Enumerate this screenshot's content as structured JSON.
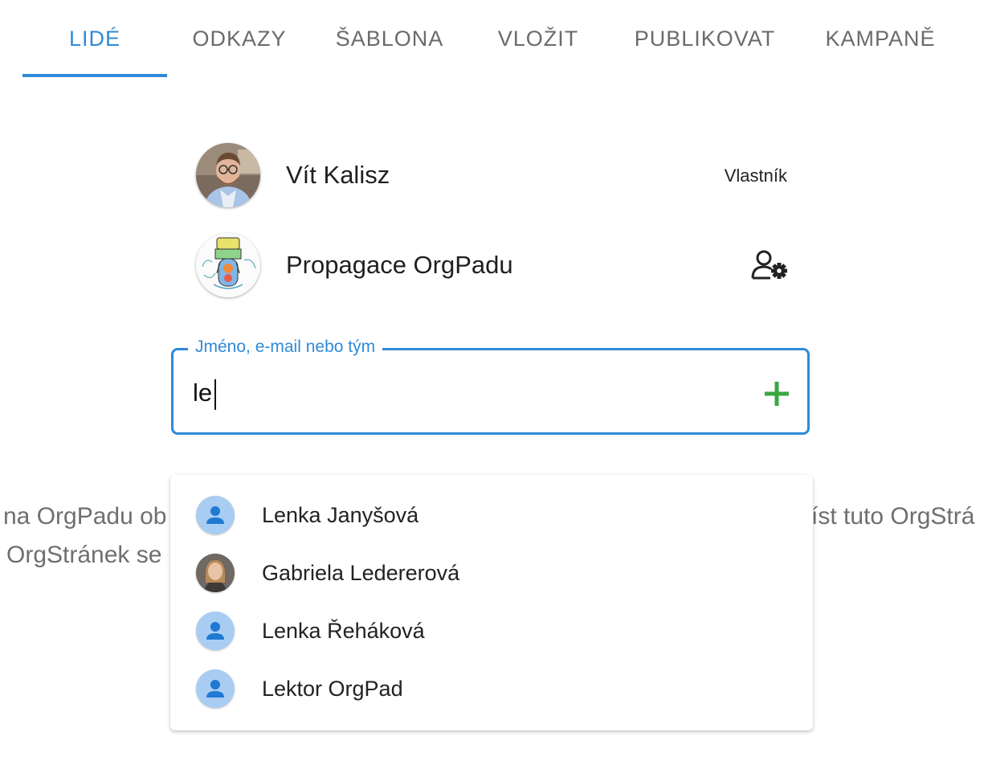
{
  "tabs": [
    {
      "label": "LIDÉ",
      "active": true
    },
    {
      "label": "ODKAZY",
      "active": false
    },
    {
      "label": "ŠABLONA",
      "active": false
    },
    {
      "label": "VLOŽIT",
      "active": false
    },
    {
      "label": "PUBLIKOVAT",
      "active": false
    },
    {
      "label": "KAMPANĚ",
      "active": false
    }
  ],
  "members": [
    {
      "name": "Vít Kalisz",
      "role": "Vlastník",
      "avatar": "person-photo"
    },
    {
      "name": "Propagace OrgPadu",
      "action_icon": "user-gear-icon",
      "avatar": "team-drawing"
    }
  ],
  "search": {
    "label": "Jméno, e-mail nebo tým",
    "value": "le",
    "add_icon": "plus-icon"
  },
  "background_text": {
    "line1_left": "na OrgPadu ob",
    "line1_right": "íst tuto OrgStrá",
    "line2_left": "OrgStránek se"
  },
  "suggestions": [
    {
      "name": "Lenka Janyšová",
      "avatar": "default-person-icon"
    },
    {
      "name": "Gabriela Ledererová",
      "avatar": "person-photo"
    },
    {
      "name": "Lenka Řeháková",
      "avatar": "default-person-icon"
    },
    {
      "name": "Lektor OrgPad",
      "avatar": "default-person-icon"
    }
  ],
  "colors": {
    "accent": "#2f8ad8",
    "add_green": "#3aa641",
    "default_avatar_bg": "#a9cdf2",
    "default_avatar_fg": "#2079d2"
  }
}
